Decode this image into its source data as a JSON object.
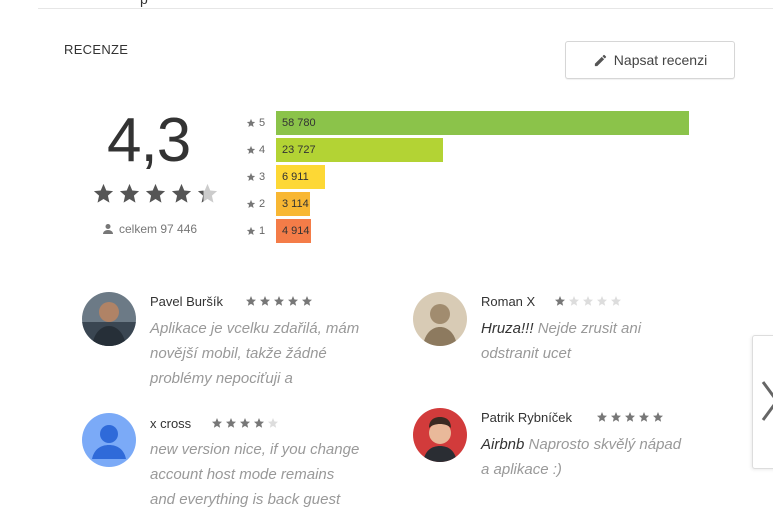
{
  "section": {
    "title": "RECENZE",
    "write_button": "Napsat recenzi",
    "top_fragment": "p"
  },
  "rating": {
    "score": "4,3",
    "stars_value": 4.3,
    "total_label": "celkem 97 446"
  },
  "distribution": [
    {
      "star": "5",
      "count": "58 780",
      "value": 58780,
      "color": "#8bc34a"
    },
    {
      "star": "4",
      "count": "23 727",
      "value": 23727,
      "color": "#b3d334"
    },
    {
      "star": "3",
      "count": "6 911",
      "value": 6911,
      "color": "#fdd835"
    },
    {
      "star": "2",
      "count": "3 114",
      "value": 3114,
      "color": "#f8b733"
    },
    {
      "star": "1",
      "count": "4 914",
      "value": 4914,
      "color": "#f47c48"
    }
  ],
  "reviews": [
    {
      "name": "Pavel Buršík",
      "stars": 5,
      "title": "",
      "body_lines": [
        "Aplikace je vcelku zdařilá, mám",
        "novější mobil, takže žádné",
        "problémy nepociťuji a"
      ]
    },
    {
      "name": "Roman X",
      "stars": 1,
      "title": "Hruza!!!",
      "body_lines": [
        "Nejde zrusit ani",
        "odstranit ucet"
      ]
    },
    {
      "name": "x cross",
      "stars": 4,
      "title": "",
      "body_lines": [
        "new version nice, if you change",
        "account host mode remains",
        "and everything is back guest"
      ]
    },
    {
      "name": "Patrik Rybníček",
      "stars": 5,
      "title": "Airbnb",
      "body_lines": [
        "Naprosto skvělý nápad",
        "a aplikace :)"
      ]
    }
  ],
  "icons": {
    "pencil": "pencil-icon",
    "person": "person-icon",
    "star": "star-icon",
    "next": "chevron-right-icon"
  }
}
